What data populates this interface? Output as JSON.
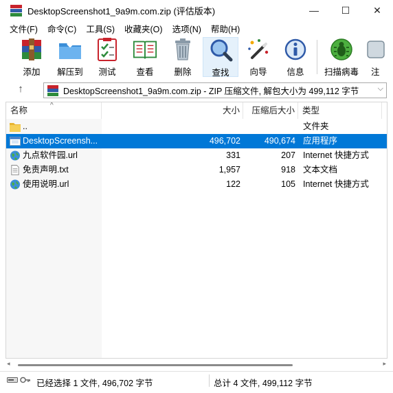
{
  "window": {
    "title": "DesktopScreenshot1_9a9m.com.zip (评估版本)",
    "minimize": "—",
    "maximize": "☐",
    "close": "✕"
  },
  "menu": [
    "文件(F)",
    "命令(C)",
    "工具(S)",
    "收藏夹(O)",
    "选项(N)",
    "帮助(H)"
  ],
  "toolbar": {
    "add": "添加",
    "extract": "解压到",
    "test": "测试",
    "view": "查看",
    "delete": "删除",
    "find": "查找",
    "wizard": "向导",
    "info": "信息",
    "virusscan": "扫描病毒",
    "more": "注"
  },
  "address": {
    "text": "DesktopScreenshot1_9a9m.com.zip - ZIP 压缩文件, 解包大小为 499,112 字节"
  },
  "columns": {
    "name": "名称",
    "size": "大小",
    "packed": "压缩后大小",
    "type": "类型"
  },
  "files": [
    {
      "name": "..",
      "size": "",
      "packed": "",
      "type": "文件夹",
      "icon": "folder-icon"
    },
    {
      "name": "DesktopScreensh...",
      "size": "496,702",
      "packed": "490,674",
      "type": "应用程序",
      "icon": "exe-icon"
    },
    {
      "name": "九点软件园.url",
      "size": "331",
      "packed": "207",
      "type": "Internet 快捷方式",
      "icon": "globe-icon"
    },
    {
      "name": "免责声明.txt",
      "size": "1,957",
      "packed": "918",
      "type": "文本文档",
      "icon": "text-file-icon"
    },
    {
      "name": "使用说明.url",
      "size": "122",
      "packed": "105",
      "type": "Internet 快捷方式",
      "icon": "globe-icon"
    }
  ],
  "status": {
    "selected": "已经选择 1 文件, 496,702 字节",
    "total": "总计 4 文件, 499,112 字节"
  },
  "colors": {
    "selection": "#0078d7",
    "rar_red": "#c8232c",
    "rar_blue": "#2f5aa8",
    "rar_green": "#2e8b3c"
  }
}
